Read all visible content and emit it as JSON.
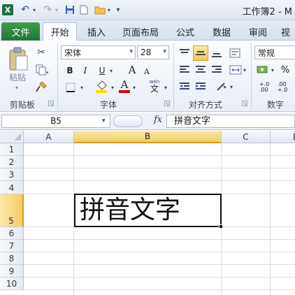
{
  "window": {
    "title": "工作簿2 - M",
    "app_icon_letter": "X"
  },
  "quick_access": [
    {
      "name": "undo",
      "glyph": "↶"
    },
    {
      "name": "redo",
      "glyph": "↷"
    },
    {
      "name": "save",
      "glyph": "▣"
    },
    {
      "name": "new",
      "glyph": "▯"
    },
    {
      "name": "open",
      "glyph": "▱"
    }
  ],
  "tabs": [
    {
      "label": "文件"
    },
    {
      "label": "开始"
    },
    {
      "label": "插入"
    },
    {
      "label": "页面布局"
    },
    {
      "label": "公式"
    },
    {
      "label": "数据"
    },
    {
      "label": "审阅"
    },
    {
      "label": "视"
    }
  ],
  "ribbon": {
    "clipboard": {
      "paste_label": "粘贴",
      "group_label": "剪贴板"
    },
    "font": {
      "font_name": "宋体",
      "font_size": "28",
      "bold": "B",
      "italic": "I",
      "underline": "U",
      "grow": "A",
      "shrink": "A",
      "font_color_letter": "A",
      "wen": "wén",
      "wen_char": "文",
      "group_label": "字体",
      "font_color": "#d00000",
      "fill_color": "#f7e000"
    },
    "alignment": {
      "group_label": "对齐方式"
    },
    "number": {
      "format": "常规",
      "percent": "%",
      "group_label": "数字",
      "dec_increase": "+.0\n.00",
      "dec_decrease": ".00\n+.0"
    }
  },
  "formula_bar": {
    "name_box": "B5",
    "fx": "fx",
    "content": "拼音文字"
  },
  "sheet": {
    "columns": [
      "A",
      "B",
      "C",
      "D"
    ],
    "rows": [
      "1",
      "2",
      "3",
      "4",
      "5",
      "6",
      "7",
      "8",
      "9",
      "10"
    ],
    "selected_cell": "B5",
    "cell_b5_value": "拼音文字"
  }
}
